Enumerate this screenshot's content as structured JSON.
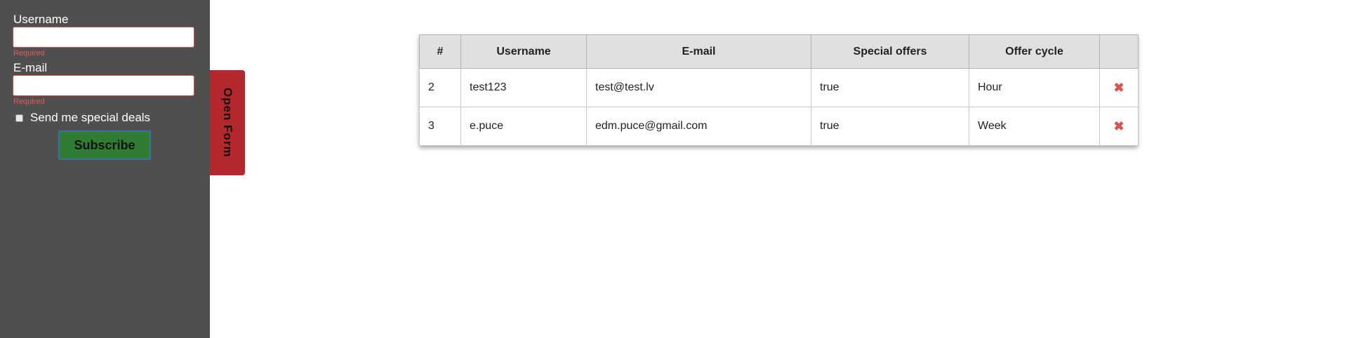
{
  "form": {
    "username_label": "Username",
    "username_value": "",
    "username_error": "Required",
    "email_label": "E-mail",
    "email_value": "",
    "email_error": "Required",
    "checkbox_label": "Send me special deals",
    "checkbox_checked": false,
    "subscribe_label": "Subscribe"
  },
  "toggle_tab": {
    "label": "Open Form"
  },
  "table": {
    "headers": [
      "#",
      "Username",
      "E-mail",
      "Special offers",
      "Offer cycle",
      ""
    ],
    "rows": [
      {
        "id": "2",
        "username": "test123",
        "email": "test@test.lv",
        "special_offers": "true",
        "offer_cycle": "Hour",
        "delete_icon": "✖"
      },
      {
        "id": "3",
        "username": "e.puce",
        "email": "edm.puce@gmail.com",
        "special_offers": "true",
        "offer_cycle": "Week",
        "delete_icon": "✖"
      }
    ]
  },
  "colors": {
    "sidebar_bg": "#4f4f4f",
    "error_red": "#d94747",
    "subscribe_green": "#2e7d32",
    "tab_red": "#b3282d",
    "delete_red": "#d9534f",
    "table_header_bg": "#e0e0e0"
  }
}
